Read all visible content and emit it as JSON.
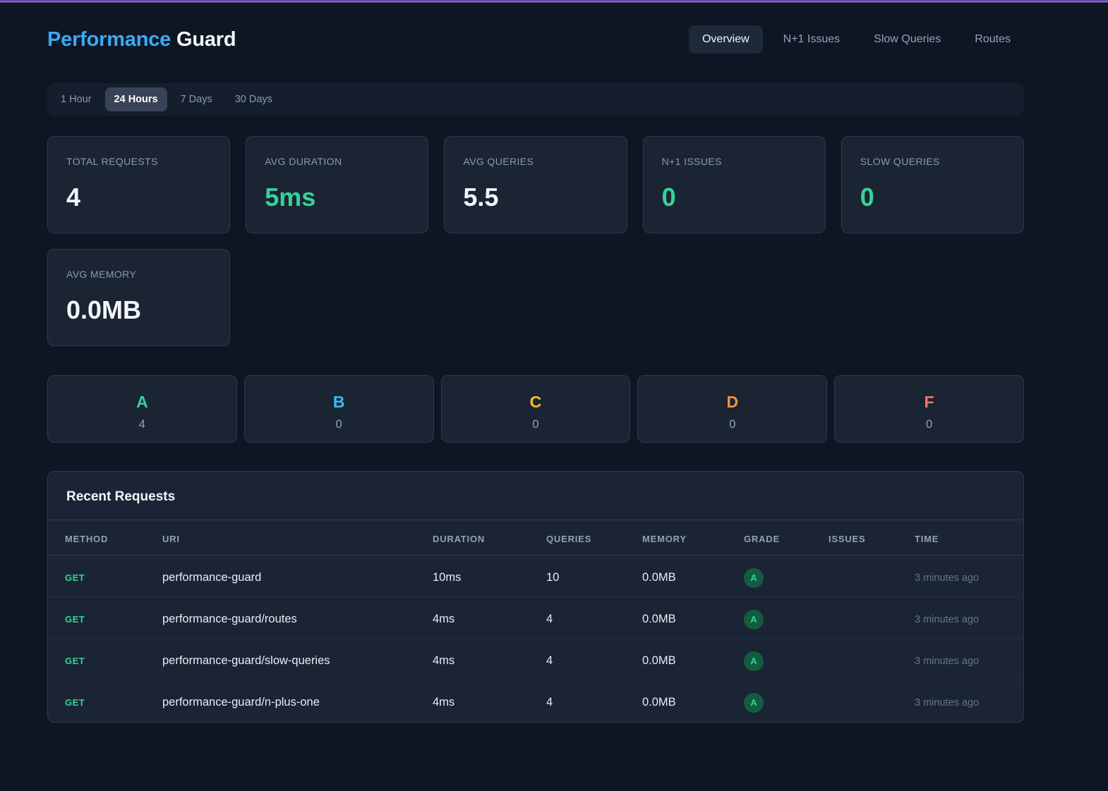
{
  "theme": {
    "accent_purple": "#6b46a8",
    "title_blue": "#3caaf4",
    "green": "#34d399",
    "background": "#0e1624",
    "card_background": "#1a2433"
  },
  "header": {
    "title_primary": "Performance",
    "title_secondary": "Guard",
    "nav": [
      {
        "label": "Overview",
        "active": true
      },
      {
        "label": "N+1 Issues",
        "active": false
      },
      {
        "label": "Slow Queries",
        "active": false
      },
      {
        "label": "Routes",
        "active": false
      }
    ]
  },
  "time_range": {
    "options": [
      {
        "label": "1 Hour",
        "active": false
      },
      {
        "label": "24 Hours",
        "active": true
      },
      {
        "label": "7 Days",
        "active": false
      },
      {
        "label": "30 Days",
        "active": false
      }
    ]
  },
  "stats": [
    {
      "label": "TOTAL REQUESTS",
      "value": "4",
      "color": "#f2f5f9"
    },
    {
      "label": "AVG DURATION",
      "value": "5ms",
      "color": "#34d399"
    },
    {
      "label": "AVG QUERIES",
      "value": "5.5",
      "color": "#f2f5f9"
    },
    {
      "label": "N+1 ISSUES",
      "value": "0",
      "color": "#34d399"
    },
    {
      "label": "SLOW QUERIES",
      "value": "0",
      "color": "#34d399"
    },
    {
      "label": "AVG MEMORY",
      "value": "0.0MB",
      "color": "#f2f5f9"
    }
  ],
  "grades": [
    {
      "letter": "A",
      "count": "4",
      "color": "#34d399"
    },
    {
      "letter": "B",
      "count": "0",
      "color": "#38bdf8"
    },
    {
      "letter": "C",
      "count": "0",
      "color": "#fbbf24"
    },
    {
      "letter": "D",
      "count": "0",
      "color": "#fb923c"
    },
    {
      "letter": "F",
      "count": "0",
      "color": "#f87171"
    }
  ],
  "recent_requests": {
    "title": "Recent Requests",
    "columns": {
      "method": "METHOD",
      "uri": "URI",
      "duration": "DURATION",
      "queries": "QUERIES",
      "memory": "MEMORY",
      "grade": "GRADE",
      "issues": "ISSUES",
      "time": "TIME"
    },
    "rows": [
      {
        "method": "GET",
        "uri": "performance-guard",
        "duration": "10ms",
        "queries": "10",
        "memory": "0.0MB",
        "grade": "A",
        "issues": "",
        "time": "3 minutes ago"
      },
      {
        "method": "GET",
        "uri": "performance-guard/routes",
        "duration": "4ms",
        "queries": "4",
        "memory": "0.0MB",
        "grade": "A",
        "issues": "",
        "time": "3 minutes ago"
      },
      {
        "method": "GET",
        "uri": "performance-guard/slow-queries",
        "duration": "4ms",
        "queries": "4",
        "memory": "0.0MB",
        "grade": "A",
        "issues": "",
        "time": "3 minutes ago"
      },
      {
        "method": "GET",
        "uri": "performance-guard/n-plus-one",
        "duration": "4ms",
        "queries": "4",
        "memory": "0.0MB",
        "grade": "A",
        "issues": "",
        "time": "3 minutes ago"
      }
    ]
  }
}
